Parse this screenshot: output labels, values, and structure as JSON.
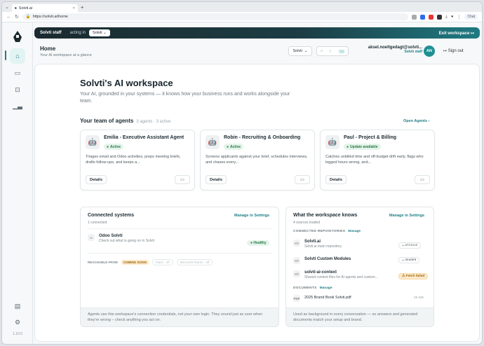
{
  "browser": {
    "tab_title": "Solvti.ai",
    "url": "https://solvti.ai/home",
    "chat_label": "Chat"
  },
  "sidebar": {
    "version": "1.10.0",
    "items": [
      {
        "icon": "home-icon"
      },
      {
        "icon": "message-icon"
      },
      {
        "icon": "robot-icon"
      },
      {
        "icon": "chart-icon"
      }
    ]
  },
  "banner": {
    "brand": "Solvti staff",
    "acting_label": "acting in",
    "workspace": "Solvti",
    "exit_label": "Exit workspace"
  },
  "header": {
    "title": "Home",
    "subtitle": "Your AI workspace at a glance",
    "workspace_select": "Solvti",
    "user_email": "aksel.noeltgedagt@solvti...",
    "user_role": "Solvti staff",
    "avatar_initials": "AN",
    "signout_label": "Sign out"
  },
  "main": {
    "title": "Solvti's AI workspace",
    "lead": "Your AI, grounded in your systems — it knows how your business runs and works alongside your team.",
    "team_title": "Your team of agents",
    "team_count": "3 agents · 3 active",
    "open_agents": "Open Agents ›"
  },
  "agents": [
    {
      "name": "Emilia - Executive Assistant Agent",
      "status": "Active",
      "desc": "Triages email and Odoo activities, preps meeting briefs, drafts follow-ups, and keeps a...",
      "details": "Details"
    },
    {
      "name": "Robin - Recruiting & Onboarding",
      "status": "Active",
      "desc": "Screens applicants against your brief, schedules interviews, and chases every...",
      "details": "Details"
    },
    {
      "name": "Paul - Project & Billing",
      "status": "Update available",
      "desc": "Catches unbilled time and off-budget drift early, flags who logged hours wrong, and...",
      "details": "Details"
    }
  ],
  "connected": {
    "title": "Connected systems",
    "count": "1 connected",
    "manage": "Manage in Settings",
    "system_name": "Odoo Solvti",
    "system_desc": "Check out what is going on in Solvti",
    "status": "Healthy",
    "reachable_label": "REACHABLE FROM",
    "coming_soon": "COMING SOON",
    "slack": "Slack · off",
    "teams": "Microsoft Teams · off",
    "footer": "Agents use this workspace's connection credentials, not your own login. They sound just as sure when they're wrong – check anything you act on."
  },
  "knowledge": {
    "title": "What the workspace knows",
    "count": "4 sources loaded",
    "manage": "Manage in Settings",
    "repos_label": "CONNECTED REPOSITORIES",
    "repos_manage": "Manage",
    "repos": [
      {
        "name": "Solvti.ai",
        "desc": "Solvti.ai main repository",
        "tag": "a7c1cc2"
      },
      {
        "name": "Solvti Custom Modules",
        "desc": "",
        "tag": "3eade5"
      },
      {
        "name": "solvti-ai-context",
        "desc": "Shared context files for AI agents and custom...",
        "tag": "Fetch failed"
      }
    ],
    "docs_label": "DOCUMENTS",
    "docs_manage": "Manage",
    "doc_type": "PDF",
    "doc_name": "2025 Brand Book Solvti.pdf",
    "doc_size": "29 MB",
    "footer": "Used as background in every conversation — so answers and generated documents match your setup and brand."
  }
}
